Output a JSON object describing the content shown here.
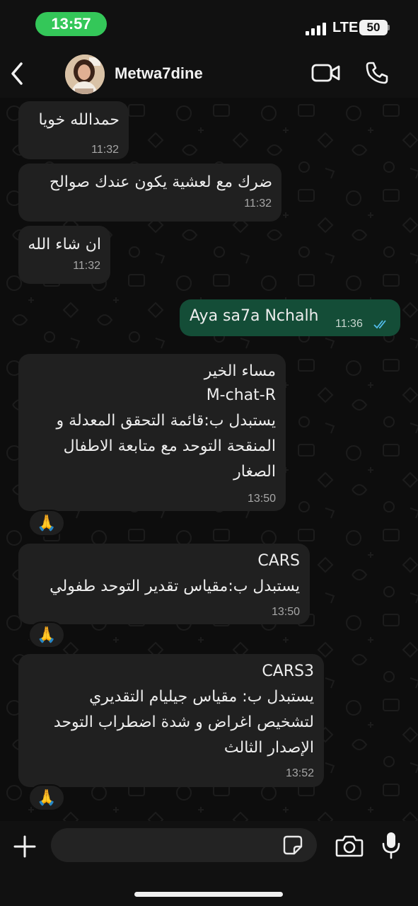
{
  "status_bar": {
    "time": "13:57",
    "network": "LTE",
    "battery": "50"
  },
  "header": {
    "contact_name": "Metwa7dine"
  },
  "messages": [
    {
      "direction": "incoming",
      "lines": [
        "حمدالله خويا"
      ],
      "time": "11:32"
    },
    {
      "direction": "incoming",
      "lines": [
        "ضرك مع لعشية يكون عندك صوالح"
      ],
      "time": "11:32"
    },
    {
      "direction": "incoming",
      "lines": [
        "ان شاء الله"
      ],
      "time": "11:32"
    },
    {
      "direction": "outgoing",
      "lines": [
        "Aya sa7a Nchalh"
      ],
      "time": "11:36",
      "status": "read"
    },
    {
      "direction": "incoming",
      "lines": [
        "مساء الخير",
        "M-chat-R",
        "يستبدل ب:قائمة التحقق المعدلة و",
        "المنقحة التوحد مع متابعة الاطفال",
        "الصغار"
      ],
      "time": "13:50",
      "reaction": "🙏"
    },
    {
      "direction": "incoming",
      "lines": [
        "CARS",
        "يستبدل ب:مقياس تقدير التوحد طفولي"
      ],
      "time": "13:50",
      "reaction": "🙏"
    },
    {
      "direction": "incoming",
      "lines": [
        "CARS3",
        "يستبدل ب: مقياس جيليام التقديري",
        "لتشخيص اغراض و شدة اضطراب التوحد",
        "الإصدار الثالث"
      ],
      "time": "13:52",
      "reaction": "🙏"
    }
  ],
  "composer": {
    "placeholder": ""
  },
  "colors": {
    "accent": "#34c759",
    "incoming_bubble": "#202020",
    "outgoing_bubble": "#144d37",
    "read_ticks": "#53bdeb"
  },
  "icons": {
    "back": "chevron-left-icon",
    "video": "video-camera-icon",
    "call": "phone-icon",
    "plus": "plus-icon",
    "sticker": "sticker-icon",
    "camera": "camera-icon",
    "mic": "microphone-icon"
  }
}
